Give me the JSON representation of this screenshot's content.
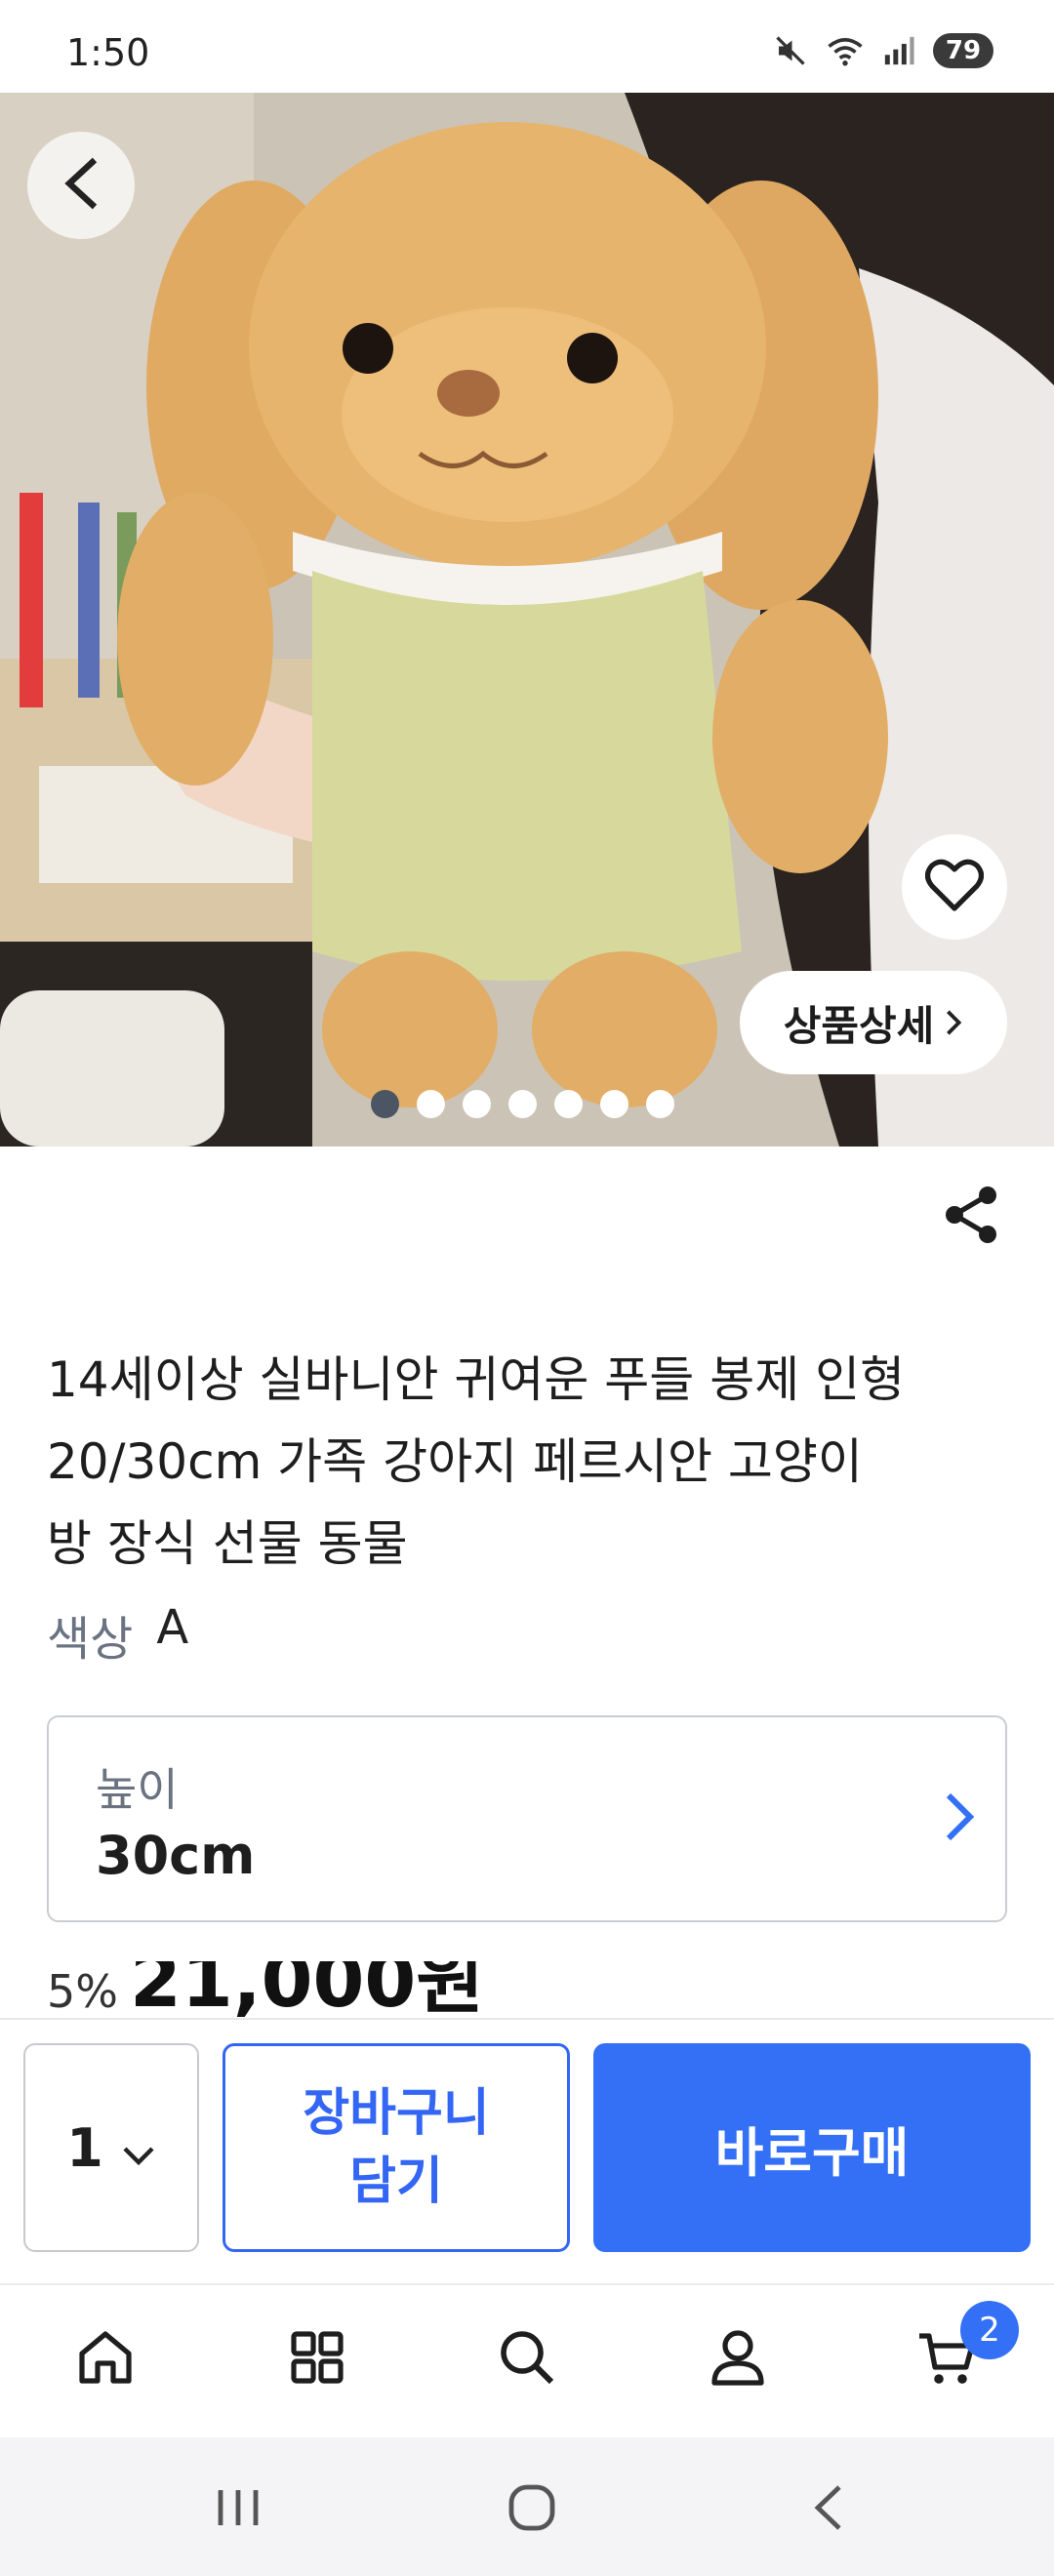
{
  "status_bar": {
    "time": "1:50",
    "battery": "79",
    "icons": [
      "mute-icon",
      "wifi-icon",
      "signal-icon",
      "battery-icon"
    ]
  },
  "hero": {
    "image_count": 7,
    "active_index": 0,
    "detail_button_label": "상품상세",
    "icons": [
      "back-arrow-icon",
      "heart-icon",
      "chevron-right-icon"
    ]
  },
  "product": {
    "title_lines": [
      "14세이상 실바니안 귀여운 푸들 봉제 인형",
      "20/30cm 가족 강아지 페르시안 고양이",
      "방 장식 선물 동물"
    ],
    "color_label": "색상",
    "color_value": "A",
    "height_label": "높이",
    "height_value": "30cm",
    "discount": "5%",
    "price": "21,000원"
  },
  "actions": {
    "quantity": "1",
    "cart_label_line1": "장바구니",
    "cart_label_line2": "담기",
    "buy_label": "바로구매"
  },
  "tab_bar": {
    "items": [
      "home-icon",
      "categories-icon",
      "search-icon",
      "profile-icon",
      "cart-icon"
    ],
    "cart_badge": "2"
  },
  "system_nav": [
    "recent-apps-icon",
    "home-circle-icon",
    "back-icon"
  ],
  "colors": {
    "accent": "#3370f6",
    "secondary_text": "#6b7280",
    "border": "#c9ccd3"
  }
}
